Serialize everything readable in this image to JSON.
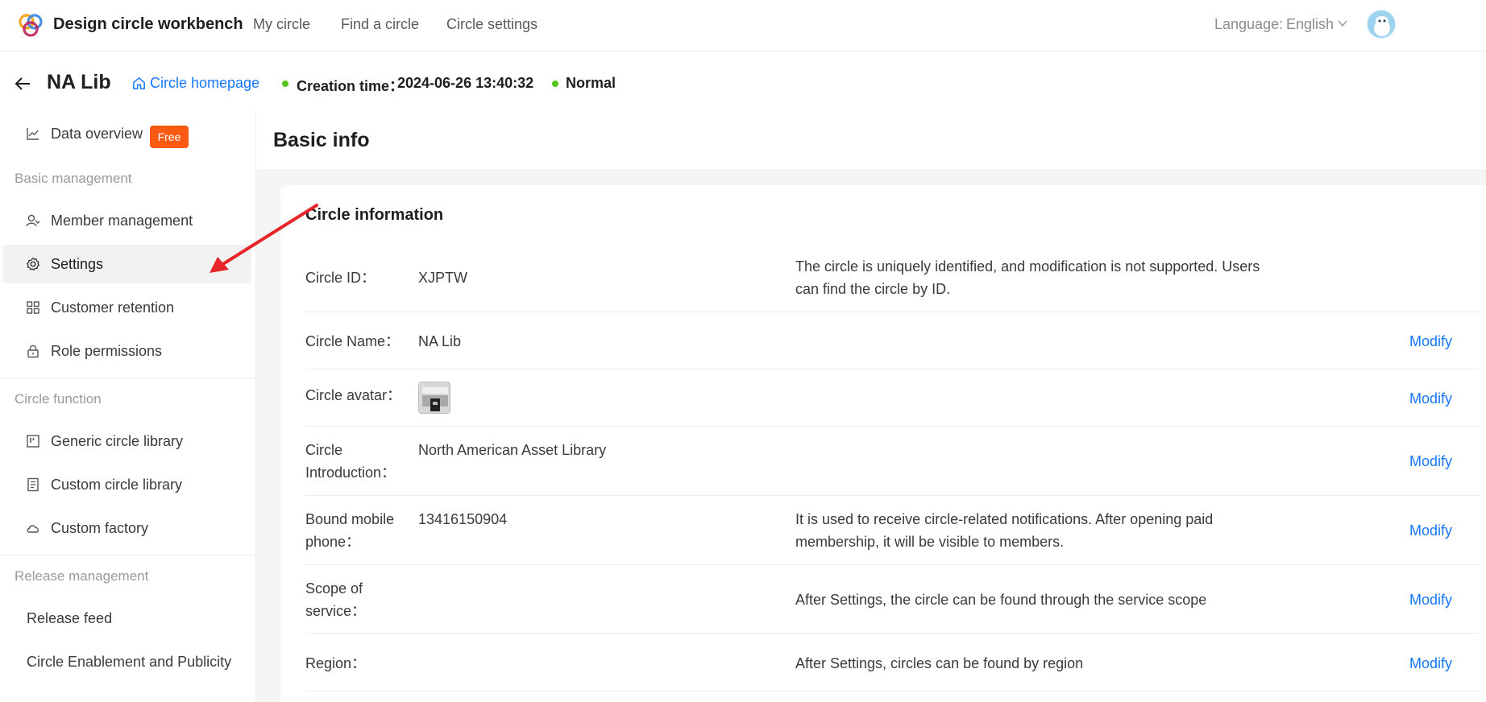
{
  "topbar": {
    "brand": "Design circle workbench",
    "nav": [
      "My circle",
      "Find a circle",
      "Circle settings"
    ],
    "language_label": "Language:",
    "language_value": "English"
  },
  "header": {
    "title": "NA Lib",
    "home_link": "Circle homepage",
    "creation_label": "Creation time：",
    "creation_value": "2024-06-26 13:40:32",
    "status": "Normal",
    "status_color": "#52c41a"
  },
  "sidebar": {
    "data_overview": "Data overview",
    "free_badge": "Free",
    "group_basic": "Basic management",
    "member_management": "Member management",
    "settings": "Settings",
    "customer_retention": "Customer retention",
    "role_permissions": "Role permissions",
    "group_function": "Circle function",
    "generic_library": "Generic circle library",
    "custom_library": "Custom circle library",
    "custom_factory": "Custom factory",
    "group_release": "Release management",
    "release_feed": "Release feed",
    "enablement": "Circle Enablement and Publicity"
  },
  "main": {
    "page_title": "Basic info",
    "card_title": "Circle information",
    "modify_label": "Modify",
    "rows": {
      "id": {
        "label": "Circle ID：",
        "value": "XJPTW",
        "desc": "The circle is uniquely identified, and modification is not supported. Users can find the circle by ID."
      },
      "name": {
        "label": "Circle Name：",
        "value": "NA Lib"
      },
      "avatar": {
        "label": "Circle avatar："
      },
      "intro": {
        "label": "Circle Introduction：",
        "value": "North American Asset Library"
      },
      "phone": {
        "label": "Bound mobile phone：",
        "value": "13416150904",
        "desc": "It is used to receive circle-related notifications. After opening paid membership, it will be visible to members."
      },
      "scope": {
        "label": "Scope of service：",
        "desc": "After Settings, the circle can be found through the service scope"
      },
      "region": {
        "label": "Region：",
        "desc": "After Settings, circles can be found by region"
      }
    }
  },
  "colors": {
    "accent": "#1677ff",
    "badge": "#fa5a14",
    "annotation": "#e5252a"
  }
}
